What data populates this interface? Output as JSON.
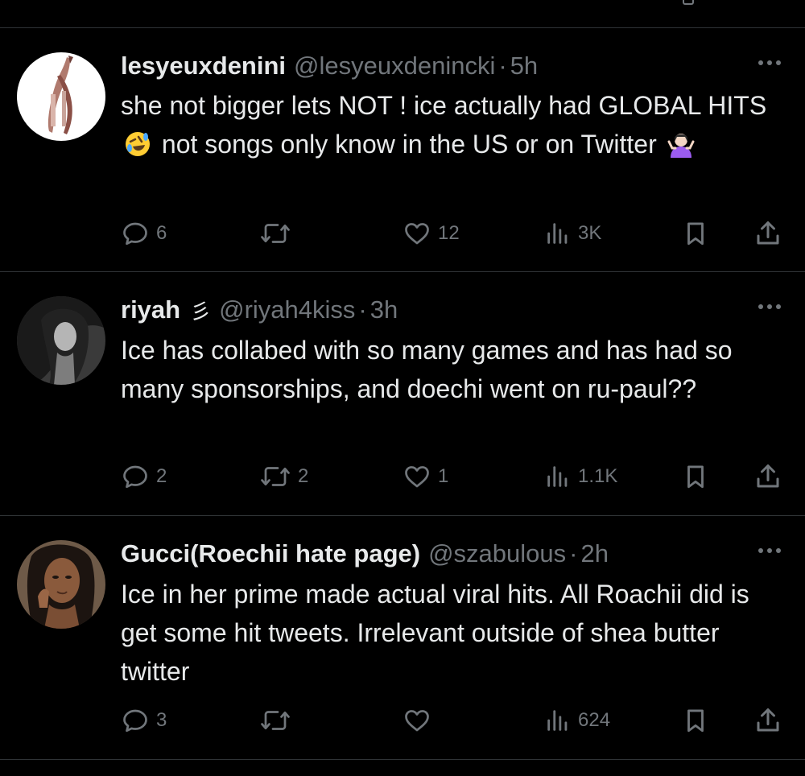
{
  "colors": {
    "background": "#000000",
    "text": "#e7e9ea",
    "muted": "#71767b",
    "divider": "#2f3336"
  },
  "tweets": [
    {
      "display_name": "lesyeuxdenini",
      "handle": "@lesyeuxdenincki",
      "separator": "·",
      "time": "5h",
      "badge": "",
      "text_parts": [
        "she not bigger lets NOT ! ice actually had GLOBAL HITS",
        "not songs only know in the US or on Twitter"
      ],
      "emojis": [
        "rolling-on-floor-laughing",
        "shrugging"
      ],
      "replies": "6",
      "reposts": "",
      "likes": "12",
      "views": "3K"
    },
    {
      "display_name": "riyah",
      "handle": "@riyah4kiss",
      "separator": "·",
      "time": "3h",
      "badge": "彡",
      "text_parts": [
        "Ice has collabed with so many games and has had so many sponsorships, and doechi went on ru-paul??"
      ],
      "emojis": [],
      "replies": "2",
      "reposts": "2",
      "likes": "1",
      "views": "1.1K"
    },
    {
      "display_name": "Gucci(Roechii hate page)",
      "handle": "@szabulous",
      "separator": "·",
      "time": "2h",
      "badge": "",
      "text_parts": [
        "Ice in her prime made actual viral hits. All Roachii did is get some hit tweets. Irrelevant outside of shea butter twitter"
      ],
      "emojis": [],
      "replies": "3",
      "reposts": "",
      "likes": "",
      "views": "624"
    }
  ]
}
